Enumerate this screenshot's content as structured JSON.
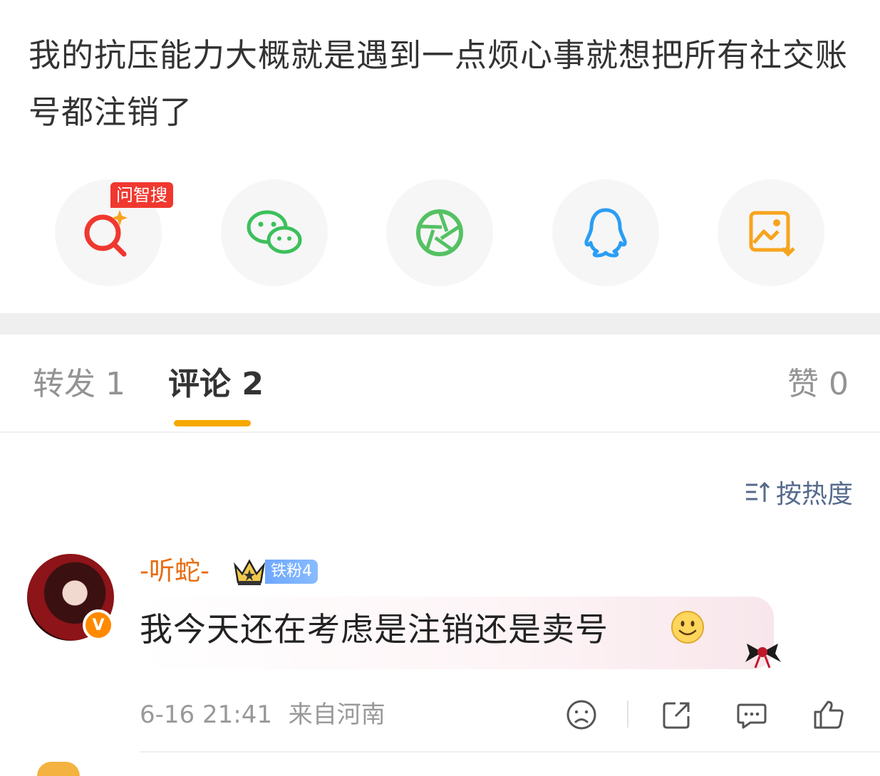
{
  "post": {
    "text": "我的抗压能力大概就是遇到一点烦心事就想把所有社交账号都注销了"
  },
  "share": {
    "badge": "问智搜",
    "items": [
      {
        "icon": "ai-search-icon",
        "color": "#f0382f"
      },
      {
        "icon": "wechat-icon",
        "color": "#3cc05b"
      },
      {
        "icon": "moments-icon",
        "color": "#55c163"
      },
      {
        "icon": "qq-icon",
        "color": "#2a9df4"
      },
      {
        "icon": "save-image-icon",
        "color": "#f7a41e"
      }
    ]
  },
  "tabs": {
    "repost": "转发 1",
    "comment": "评论 2",
    "like": "赞 0"
  },
  "sort": {
    "label": "按热度"
  },
  "comment": {
    "username": "-听蛇-",
    "fan_badge": "铁粉4",
    "text": "我今天还在考虑是注销还是卖号",
    "time": "6-16 21:41",
    "location": "来自河南",
    "verified_mark": "V"
  },
  "colors": {
    "accent": "#f7a800",
    "username": "#e86b0f",
    "sort": "#566b8c"
  }
}
